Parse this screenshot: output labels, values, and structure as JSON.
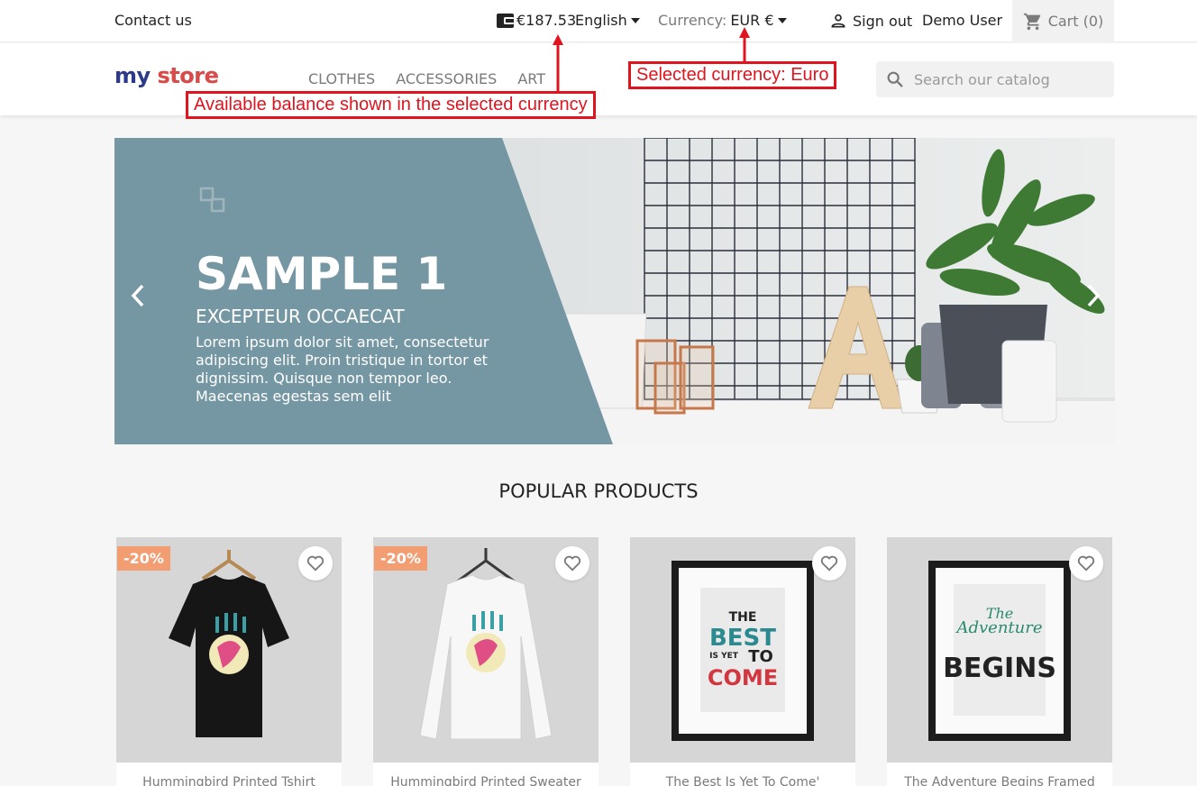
{
  "topbar": {
    "contact": "Contact us",
    "balance": "€187.53",
    "language": "English",
    "currency_label": "Currency:",
    "currency_value": "EUR €",
    "signout": "Sign out",
    "user": "Demo User",
    "cart": "Cart (0)"
  },
  "header": {
    "logo_text": [
      "my",
      "store"
    ],
    "nav": [
      "CLOTHES",
      "ACCESSORIES",
      "ART"
    ],
    "search_placeholder": "Search our catalog"
  },
  "annotations": {
    "balance_note": "Available balance shown in the selected currency",
    "currency_note": "Selected currency: Euro"
  },
  "hero": {
    "title": "SAMPLE 1",
    "subtitle": "EXCEPTEUR OCCAECAT",
    "text": "Lorem ipsum dolor sit amet, consectetur adipiscing elit. Proin tristique in tortor et dignissim. Quisque non tempor leo. Maecenas egestas sem elit"
  },
  "section_title": "POPULAR PRODUCTS",
  "products": [
    {
      "name": "Hummingbird Printed Tshirt",
      "badge": "-20%"
    },
    {
      "name": "Hummingbird Printed Sweater",
      "badge": "-20%"
    },
    {
      "name": "The Best Is Yet To Come'",
      "badge": ""
    },
    {
      "name": "The Adventure Begins Framed",
      "badge": ""
    }
  ],
  "poster_text": {
    "best": [
      "THE",
      "BEST",
      "IS YET",
      "TO",
      "COME"
    ],
    "adventure": [
      "The",
      "Adventure",
      "BEGINS"
    ]
  },
  "colors": {
    "accent_annotation": "#e0141e",
    "discount_badge": "#f39d72",
    "hero_panel": "#7597a3"
  }
}
